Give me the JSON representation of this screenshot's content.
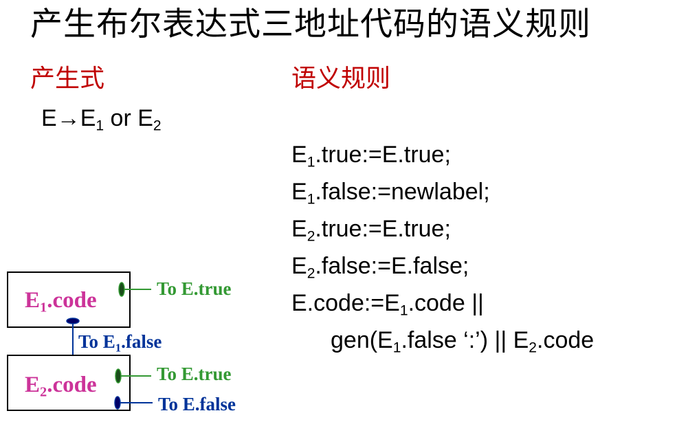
{
  "title": "产生布尔表达式三地址代码的语义规则",
  "production_heading": "产生式",
  "semantic_heading": "语义规则",
  "production": {
    "lhs": "E",
    "arrow": "→",
    "e": "E",
    "sub1": "1",
    "or": " or ",
    "sub2": "2"
  },
  "rules": [
    {
      "pre": "E",
      "sub": "1",
      "post": ".true:=E.true;"
    },
    {
      "pre": "E",
      "sub": "1",
      "post": ".false:=newlabel;"
    },
    {
      "pre": "E",
      "sub": "2",
      "post": ".true:=E.true;"
    },
    {
      "pre": "E",
      "sub": "2",
      "post": ".false:=E.false;"
    },
    {
      "pre": "E.code:=E",
      "sub": "1",
      "post": ".code ||"
    },
    {
      "pre": "gen(E",
      "sub": "1",
      "post": ".false ‘:’) || E",
      "sub2": "2",
      "post2": ".code"
    }
  ],
  "diagram": {
    "box1": {
      "pre": "E",
      "sub": "1",
      "post": ".code"
    },
    "box2": {
      "pre": "E",
      "sub": "2",
      "post": ".code"
    },
    "to_true_1": "To E.true",
    "to_false_1": {
      "pre": "To E",
      "sub": "1",
      "post": ".false"
    },
    "to_true_2": "To E.true",
    "to_false_2": "To E.false"
  },
  "colors": {
    "heading": "#c00000",
    "code_label": "#cc3399",
    "true_jump": "#339933",
    "false_jump": "#003399"
  }
}
